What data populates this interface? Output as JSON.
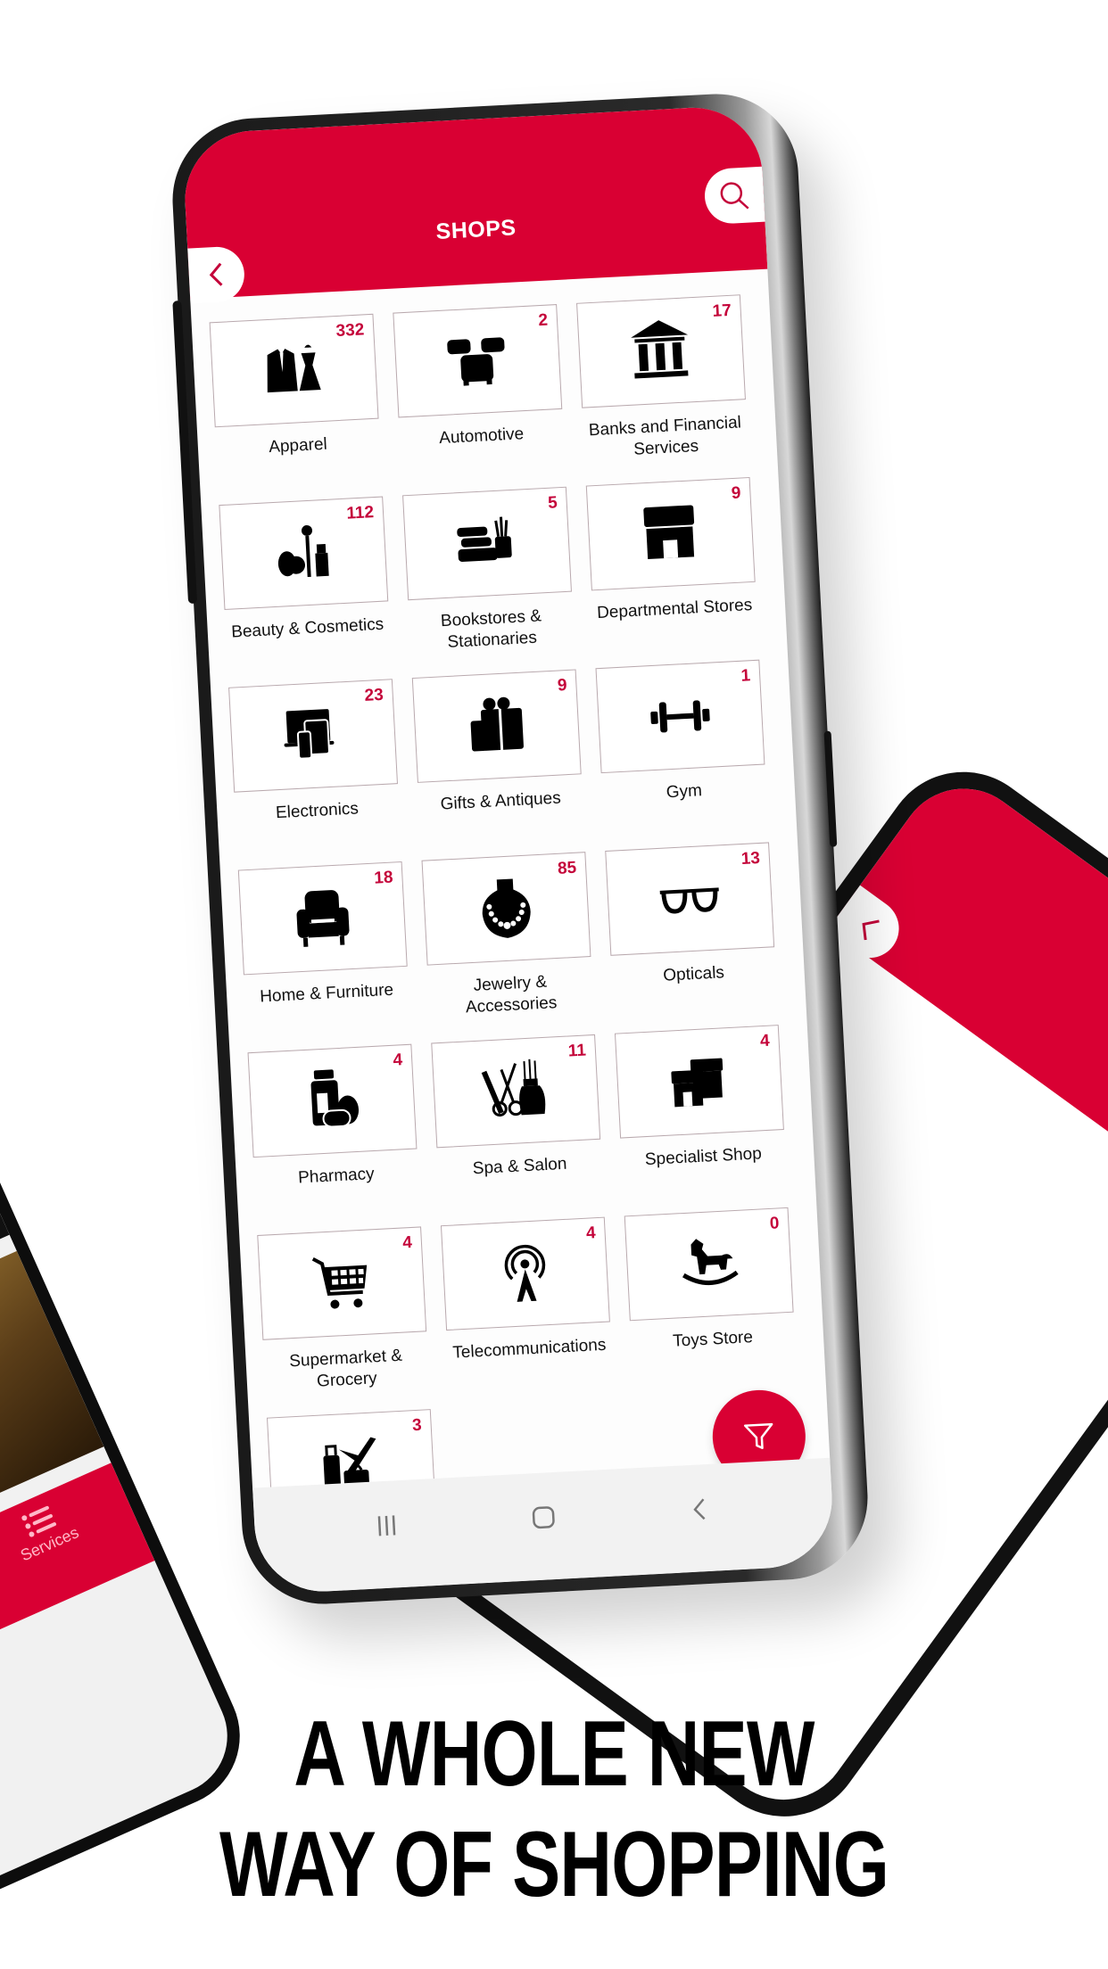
{
  "app": {
    "title": "SHOPS",
    "accent_color": "#d90033",
    "count_color": "#c4043a"
  },
  "header": {
    "back_icon": "chevron-left-icon",
    "search_icon": "search-icon"
  },
  "categories": [
    {
      "label": "Apparel",
      "count": "332",
      "icon": "apparel-icon"
    },
    {
      "label": "Automotive",
      "count": "2",
      "icon": "cars-icon"
    },
    {
      "label": "Banks and Financial Services",
      "count": "17",
      "icon": "bank-icon"
    },
    {
      "label": "Beauty & Cosmetics",
      "count": "112",
      "icon": "cosmetics-icon"
    },
    {
      "label": "Bookstores & Stationaries",
      "count": "5",
      "icon": "books-icon"
    },
    {
      "label": "Departmental Stores",
      "count": "9",
      "icon": "store-icon"
    },
    {
      "label": "Electronics",
      "count": "23",
      "icon": "devices-icon"
    },
    {
      "label": "Gifts & Antiques",
      "count": "9",
      "icon": "gift-icon"
    },
    {
      "label": "Gym",
      "count": "1",
      "icon": "dumbbell-icon"
    },
    {
      "label": "Home & Furniture",
      "count": "18",
      "icon": "armchair-icon"
    },
    {
      "label": "Jewelry & Accessories",
      "count": "85",
      "icon": "necklace-icon"
    },
    {
      "label": "Opticals",
      "count": "13",
      "icon": "glasses-icon"
    },
    {
      "label": "Pharmacy",
      "count": "4",
      "icon": "pharmacy-icon"
    },
    {
      "label": "Spa & Salon",
      "count": "11",
      "icon": "salon-icon"
    },
    {
      "label": "Specialist Shop",
      "count": "4",
      "icon": "shops-icon"
    },
    {
      "label": "Supermarket & Grocery",
      "count": "4",
      "icon": "cart-icon"
    },
    {
      "label": "Telecommunications",
      "count": "4",
      "icon": "antenna-icon"
    },
    {
      "label": "Toys Store",
      "count": "0",
      "icon": "rocking-horse-icon"
    },
    {
      "label": "",
      "count": "3",
      "icon": "travel-icon"
    }
  ],
  "fab": {
    "icon": "filter-icon"
  },
  "system_nav": {
    "recents_icon": "recents-icon",
    "home_icon": "home-icon",
    "back_icon": "back-icon"
  },
  "left_phone": {
    "tab_label": "Services",
    "tab_icon": "list-icon"
  },
  "tagline": {
    "line1": "A WHOLE NEW",
    "line2": "WAY OF SHOPPING"
  }
}
